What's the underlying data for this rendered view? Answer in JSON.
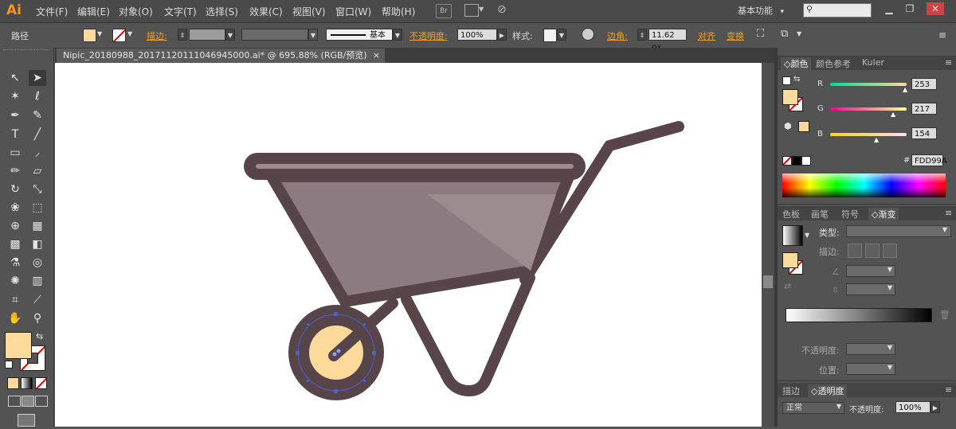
{
  "app": {
    "logo": "Ai"
  },
  "menu": [
    "文件(F)",
    "编辑(E)",
    "对象(O)",
    "文字(T)",
    "选择(S)",
    "效果(C)",
    "视图(V)",
    "窗口(W)",
    "帮助(H)"
  ],
  "menubar_icons": {
    "bridge": "Br"
  },
  "workspace": {
    "label": "基本功能",
    "arrow": "▾"
  },
  "control": {
    "object_type": "路径",
    "stroke_label": "描边:",
    "stroke_style": "基本",
    "opacity_label": "不透明度:",
    "opacity_value": "100%",
    "style_label": "样式:",
    "corner_label": "边角:",
    "corner_value": "11.62 px",
    "align_label": "对齐",
    "transform_label": "变换"
  },
  "document": {
    "tab_title": "Nipic_20180988_20171120111046945000.ai* @ 695.88% (RGB/预览)",
    "close": "×"
  },
  "color_panel": {
    "tabs": [
      "颜色",
      "颜色参考",
      "Kuler"
    ],
    "r_label": "R",
    "r_value": "253",
    "g_label": "G",
    "g_value": "217",
    "b_label": "B",
    "b_value": "154",
    "hex_label": "#",
    "hex_value": "FDD99A",
    "fill_color": "#FDD99A"
  },
  "gradient_panel": {
    "tabs": [
      "色板",
      "画笔",
      "符号",
      "渐变"
    ],
    "type_label": "类型:",
    "stroke_label": "描边:",
    "opacity_label": "不透明度:",
    "position_label": "位置:"
  },
  "transparency_panel": {
    "tabs": [
      "描边",
      "透明度"
    ],
    "mode": "正常",
    "opacity_label": "不透明度:",
    "opacity_value": "100%"
  },
  "colors": {
    "accent": "#f0a030",
    "wheelbarrow_outline": "#574549",
    "tray": "#8c7b80",
    "tray_highlight": "#9b8c90",
    "wheel_hub": "#FDD99A",
    "selection": "#4b5fd6"
  }
}
